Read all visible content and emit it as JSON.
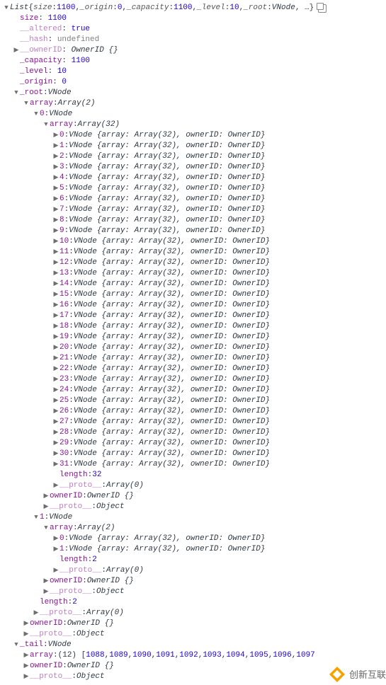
{
  "header": {
    "typeName": "List",
    "summaryParts": [
      {
        "k": "size",
        "v": "1100",
        "cls": "num"
      },
      {
        "k": "_origin",
        "v": "0",
        "cls": "num"
      },
      {
        "k": "_capacity",
        "v": "1100",
        "cls": "num"
      },
      {
        "k": "_level",
        "v": "10",
        "cls": "num"
      },
      {
        "k": "_root",
        "v": "VNode",
        "cls": "objname"
      }
    ],
    "more": "…"
  },
  "topProps": [
    {
      "key": "size",
      "val": "1100",
      "cls": "num",
      "arrow": "none"
    },
    {
      "key": "__altered",
      "val": "true",
      "cls": "bool",
      "arrow": "none",
      "faded": true
    },
    {
      "key": "__hash",
      "val": "undefined",
      "cls": "undef",
      "arrow": "none",
      "faded": true
    },
    {
      "key": "__ownerID",
      "val": "OwnerID {}",
      "cls": "objname",
      "arrow": "right",
      "faded": true
    },
    {
      "key": "_capacity",
      "val": "1100",
      "cls": "num",
      "arrow": "none"
    },
    {
      "key": "_level",
      "val": "10",
      "cls": "num",
      "arrow": "none"
    },
    {
      "key": "_origin",
      "val": "0",
      "cls": "num",
      "arrow": "none"
    }
  ],
  "rootLabel": {
    "key": "_root",
    "val": "VNode"
  },
  "rootArray": {
    "key": "array",
    "val": "Array(2)"
  },
  "node0": {
    "key": "0",
    "val": "VNode"
  },
  "node0Array": {
    "key": "array",
    "val": "Array(32)"
  },
  "vnodeItemTemplate": {
    "prefix": "VNode {array: Array(32), ownerID: OwnerID}"
  },
  "vnodeCount0": 32,
  "afterArray0": [
    {
      "key": "length",
      "val": "32",
      "cls": "num",
      "arrow": "none",
      "indent": 5
    },
    {
      "key": "__proto__",
      "val": "Array(0)",
      "cls": "objname",
      "arrow": "right",
      "indent": 5,
      "faded": true
    },
    {
      "key": "ownerID",
      "val": "OwnerID {}",
      "cls": "objname",
      "arrow": "right",
      "indent": 4
    },
    {
      "key": "__proto__",
      "val": "Object",
      "cls": "objname",
      "arrow": "right",
      "indent": 4,
      "faded": true
    }
  ],
  "node1": {
    "key": "1",
    "val": "VNode"
  },
  "node1Array": {
    "key": "array",
    "val": "Array(2)"
  },
  "vnodeCount1": 2,
  "afterArray1Inner": [
    {
      "key": "length",
      "val": "2",
      "cls": "num",
      "arrow": "none",
      "indent": 5
    },
    {
      "key": "__proto__",
      "val": "Array(0)",
      "cls": "objname",
      "arrow": "right",
      "indent": 5,
      "faded": true
    },
    {
      "key": "ownerID",
      "val": "OwnerID {}",
      "cls": "objname",
      "arrow": "right",
      "indent": 4
    },
    {
      "key": "__proto__",
      "val": "Object",
      "cls": "objname",
      "arrow": "right",
      "indent": 4,
      "faded": true
    }
  ],
  "afterOuterArray": [
    {
      "key": "length",
      "val": "2",
      "cls": "num",
      "arrow": "none",
      "indent": 3
    },
    {
      "key": "__proto__",
      "val": "Array(0)",
      "cls": "objname",
      "arrow": "right",
      "indent": 3,
      "faded": true
    },
    {
      "key": "ownerID",
      "val": "OwnerID {}",
      "cls": "objname",
      "arrow": "right",
      "indent": 2
    },
    {
      "key": "__proto__",
      "val": "Object",
      "cls": "objname",
      "arrow": "right",
      "indent": 2,
      "faded": true
    }
  ],
  "tail": {
    "key": "_tail",
    "val": "VNode"
  },
  "tailArray": {
    "key": "array",
    "prefix": "(12) [",
    "values": [
      1088,
      1089,
      1090,
      1091,
      1092,
      1093,
      1094,
      1095,
      1096,
      1097
    ],
    "suffixHidden": true
  },
  "tailAfter": [
    {
      "key": "ownerID",
      "val": "OwnerID {}",
      "cls": "objname",
      "arrow": "right",
      "indent": 2
    },
    {
      "key": "__proto__",
      "val": "Object",
      "cls": "objname",
      "arrow": "right",
      "indent": 2,
      "faded": true
    }
  ],
  "watermark": "创新互联"
}
